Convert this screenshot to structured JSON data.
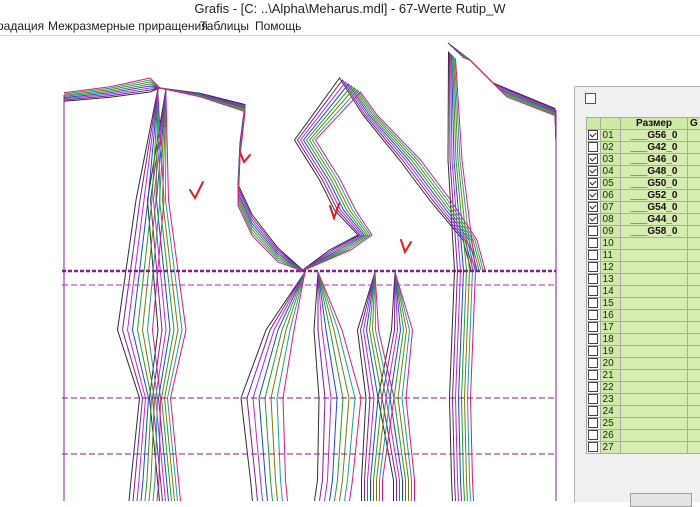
{
  "window": {
    "title": "Grafis - [C: ..\\Alpha\\Meharus.mdl] - 67-Werte Rutip_W"
  },
  "menu": {
    "items": [
      "радация",
      "Межразмерные приращения",
      "Таблицы",
      "Помощь"
    ]
  },
  "colors": {
    "accent_green": "#d0e9a7",
    "size_lines": [
      "#2d2d2d",
      "#7a1fa2",
      "#c026d3",
      "#1c47d6",
      "#1e9e33",
      "#7b7b00",
      "#1aa0a0",
      "#e0197d"
    ]
  },
  "size_table": {
    "header": [
      "Размер",
      "G"
    ],
    "rows": [
      {
        "num": "01",
        "checked": true,
        "size": "___G56_0"
      },
      {
        "num": "02",
        "checked": false,
        "size": "___G42_0"
      },
      {
        "num": "03",
        "checked": true,
        "size": "___G46_0"
      },
      {
        "num": "04",
        "checked": true,
        "size": "___G48_0"
      },
      {
        "num": "05",
        "checked": true,
        "size": "___G50_0"
      },
      {
        "num": "06",
        "checked": true,
        "size": "___G52_0"
      },
      {
        "num": "07",
        "checked": true,
        "size": "___G54_0"
      },
      {
        "num": "08",
        "checked": true,
        "size": "___G44_0"
      },
      {
        "num": "09",
        "checked": false,
        "size": "___G58_0"
      },
      {
        "num": "10",
        "checked": false,
        "size": ""
      },
      {
        "num": "11",
        "checked": false,
        "size": ""
      },
      {
        "num": "12",
        "checked": false,
        "size": ""
      },
      {
        "num": "13",
        "checked": false,
        "size": ""
      },
      {
        "num": "14",
        "checked": false,
        "size": ""
      },
      {
        "num": "15",
        "checked": false,
        "size": ""
      },
      {
        "num": "16",
        "checked": false,
        "size": ""
      },
      {
        "num": "17",
        "checked": false,
        "size": ""
      },
      {
        "num": "18",
        "checked": false,
        "size": ""
      },
      {
        "num": "19",
        "checked": false,
        "size": ""
      },
      {
        "num": "20",
        "checked": false,
        "size": ""
      },
      {
        "num": "21",
        "checked": false,
        "size": ""
      },
      {
        "num": "22",
        "checked": false,
        "size": ""
      },
      {
        "num": "23",
        "checked": false,
        "size": ""
      },
      {
        "num": "24",
        "checked": false,
        "size": ""
      },
      {
        "num": "25",
        "checked": false,
        "size": ""
      },
      {
        "num": "26",
        "checked": false,
        "size": ""
      },
      {
        "num": "27",
        "checked": false,
        "size": ""
      }
    ]
  }
}
